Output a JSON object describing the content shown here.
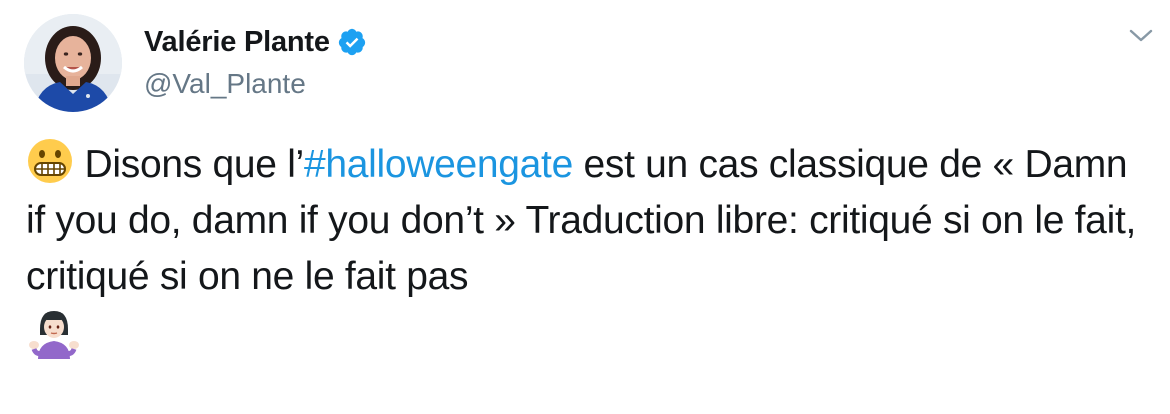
{
  "author": {
    "display_name": "Valérie Plante",
    "handle": "@Val_Plante",
    "verified": true
  },
  "tweet": {
    "segment_1": "Disons que l’",
    "hashtag": "#halloweengate",
    "segment_2": " est un cas classique de  « Damn if you do, damn if you don’t »  Traduction libre: critiqué si on le fait, critiqué si on ne le fait pas"
  },
  "icons": {
    "grimace": "grimacing-face-emoji",
    "shrug": "person-shrugging-emoji",
    "verified": "verified-badge-icon",
    "caret": "chevron-down-icon"
  },
  "colors": {
    "text": "#14171a",
    "secondary": "#657786",
    "hashtag": "#1b95e0",
    "verified": "#1da1f2"
  }
}
